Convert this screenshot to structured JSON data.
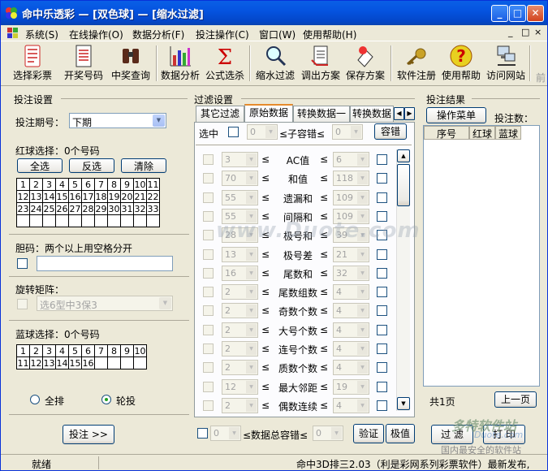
{
  "window": {
    "title": "命中乐透彩 — [双色球] — [缩水过滤]",
    "minimize": "_",
    "maximize": "□",
    "close": "✕"
  },
  "menu": [
    "系统(S)",
    "在线操作(O)",
    "数据分析(F)",
    "投注操作(C)",
    "窗口(W)",
    "使用帮助(H)"
  ],
  "mdi_controls": [
    "_",
    "□",
    "×"
  ],
  "toolbar": [
    {
      "label": "选择彩票",
      "icon": "lottery-ticket-icon"
    },
    {
      "label": "开奖号码",
      "icon": "document-list-icon"
    },
    {
      "label": "中奖查询",
      "icon": "binoculars-icon"
    },
    {
      "label": "数据分析",
      "icon": "bar-chart-icon"
    },
    {
      "label": "公式选杀",
      "icon": "sigma-icon"
    },
    {
      "label": "缩水过滤",
      "icon": "magnifier-icon"
    },
    {
      "label": "调出方案",
      "icon": "open-document-icon"
    },
    {
      "label": "保存方案",
      "icon": "save-document-icon"
    },
    {
      "label": "软件注册",
      "icon": "key-icon"
    },
    {
      "label": "使用帮助",
      "icon": "help-icon"
    },
    {
      "label": "访问网站",
      "icon": "network-computer-icon"
    },
    {
      "label": "前",
      "icon": ""
    }
  ],
  "bet_settings": {
    "title": "投注设置",
    "period_label": "投注期号：",
    "period_value": "下期",
    "red_label": "红球选择：0个号码",
    "select_all": "全选",
    "invert": "反选",
    "clear": "清除",
    "red_numbers": [
      1,
      2,
      3,
      4,
      5,
      6,
      7,
      8,
      9,
      10,
      11,
      12,
      13,
      14,
      15,
      16,
      17,
      18,
      19,
      20,
      21,
      22,
      23,
      24,
      25,
      26,
      27,
      28,
      29,
      30,
      31,
      32,
      33
    ],
    "banker_label": "胆码：两个以上用空格分开",
    "matrix_label": "旋转矩阵：",
    "matrix_value": "选6型中3保3",
    "blue_label": "蓝球选择：0个号码",
    "blue_numbers": [
      1,
      2,
      3,
      4,
      5,
      6,
      7,
      8,
      9,
      10,
      11,
      12,
      13,
      14,
      15,
      16
    ],
    "radio_full": "全排",
    "radio_wheel": "轮投",
    "bet_button": "投注 >>"
  },
  "filter": {
    "title": "过滤设置",
    "tabs": [
      "其它过滤",
      "原始数据",
      "转换数据一",
      "转换数据"
    ],
    "active_tab": "原始数据",
    "select_label": "选中",
    "sub_min": "0",
    "sub_label": "≤子容错≤",
    "sub_max": "0",
    "tolerance_button": "容错",
    "rows": [
      {
        "label": "AC值",
        "min": "3",
        "max": "6"
      },
      {
        "label": "和值",
        "min": "70",
        "max": "118"
      },
      {
        "label": "遗漏和",
        "min": "55",
        "max": "109"
      },
      {
        "label": "间隔和",
        "min": "55",
        "max": "109"
      },
      {
        "label": "极号和",
        "min": "28",
        "max": "39"
      },
      {
        "label": "极号差",
        "min": "13",
        "max": "21"
      },
      {
        "label": "尾数和",
        "min": "16",
        "max": "32"
      },
      {
        "label": "尾数组数",
        "min": "2",
        "max": "4"
      },
      {
        "label": "奇数个数",
        "min": "2",
        "max": "4"
      },
      {
        "label": "大号个数",
        "min": "2",
        "max": "4"
      },
      {
        "label": "连号个数",
        "min": "2",
        "max": "4"
      },
      {
        "label": "质数个数",
        "min": "2",
        "max": "4"
      },
      {
        "label": "最大邻距",
        "min": "12",
        "max": "19"
      },
      {
        "label": "偶数连续",
        "min": "2",
        "max": "4"
      }
    ],
    "le_symbol": "≤",
    "total_min": "0",
    "total_label": "≤数据总容错≤",
    "total_max": "0",
    "verify_button": "验证",
    "extreme_button": "极值"
  },
  "result": {
    "title": "投注结果",
    "operate_menu": "操作菜单",
    "count_label": "投注数：",
    "columns": [
      "序号",
      "红球",
      "蓝球"
    ],
    "pages": "共1页",
    "prev_page": "上一页",
    "filter_button": "过 滤",
    "print_button": "打 印"
  },
  "status": {
    "left": "就绪",
    "marquee": "命中3D排三2.03（利是彩网系列彩票软件）最新发布,"
  },
  "watermarks": {
    "center": "www.Duote.com",
    "logo": "多特软件站",
    "site": "Duote.com",
    "slogan": "国内最安全的软件站"
  },
  "colors": {
    "titlebar": "#0554e0",
    "face": "#ece9d8",
    "tab_highlight": "#e68b2c"
  }
}
